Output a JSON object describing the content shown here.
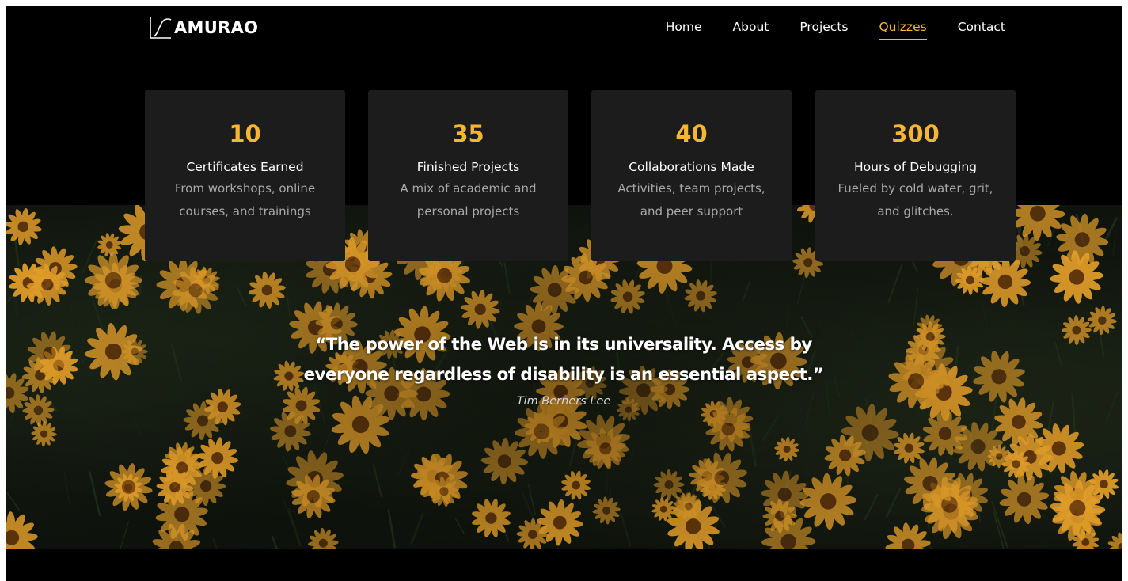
{
  "brand": {
    "name": "AMURAO",
    "accent_color": "#f6b633",
    "logo_icon": "signature-curve-icon"
  },
  "nav": {
    "items": [
      {
        "label": "Home",
        "active": false
      },
      {
        "label": "About",
        "active": false
      },
      {
        "label": "Projects",
        "active": false
      },
      {
        "label": "Quizzes",
        "active": true
      },
      {
        "label": "Contact",
        "active": false
      }
    ]
  },
  "stats": [
    {
      "number": "10",
      "title": "Certificates Earned",
      "desc": "From workshops, online courses, and trainings"
    },
    {
      "number": "35",
      "title": "Finished Projects",
      "desc": "A mix of academic and personal projects"
    },
    {
      "number": "40",
      "title": "Collaborations Made",
      "desc": "Activities, team projects, and peer support"
    },
    {
      "number": "300",
      "title": "Hours of Debugging",
      "desc": "Fueled by cold water, grit, and glitches."
    }
  ],
  "quote": {
    "text": "“The power of the Web is in its universality. Access by everyone regardless of disability is an essential aspect.”",
    "author": "Tim Berners Lee"
  },
  "colors": {
    "background": "#000000",
    "card": "#1c1c1c",
    "flower_petal": "#e7a12a",
    "flower_center": "#6b3a0c"
  }
}
